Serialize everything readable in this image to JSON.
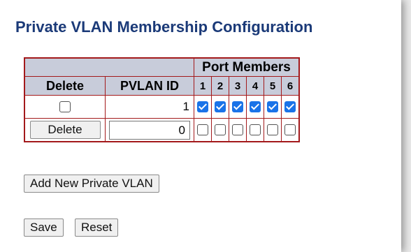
{
  "page": {
    "title": "Private VLAN Membership Configuration"
  },
  "table": {
    "group_header": "Port Members",
    "columns": {
      "delete": "Delete",
      "pvlan_id": "PVLAN ID",
      "ports": [
        "1",
        "2",
        "3",
        "4",
        "5",
        "6"
      ]
    },
    "rows": [
      {
        "delete_control": "checkbox",
        "delete_checked": false,
        "pvlan_id": "1",
        "ports_checked": [
          true,
          true,
          true,
          true,
          true,
          true
        ]
      },
      {
        "delete_control": "button",
        "delete_label": "Delete",
        "pvlan_id_input_value": "0",
        "ports_checked": [
          false,
          false,
          false,
          false,
          false,
          false
        ]
      }
    ]
  },
  "buttons": {
    "add_new": "Add New Private VLAN",
    "save": "Save",
    "reset": "Reset"
  },
  "colors": {
    "title": "#1b3a78",
    "table_border": "#a3191b",
    "header_bg": "#c8ccda",
    "checkbox_checked": "#1a73e8"
  }
}
